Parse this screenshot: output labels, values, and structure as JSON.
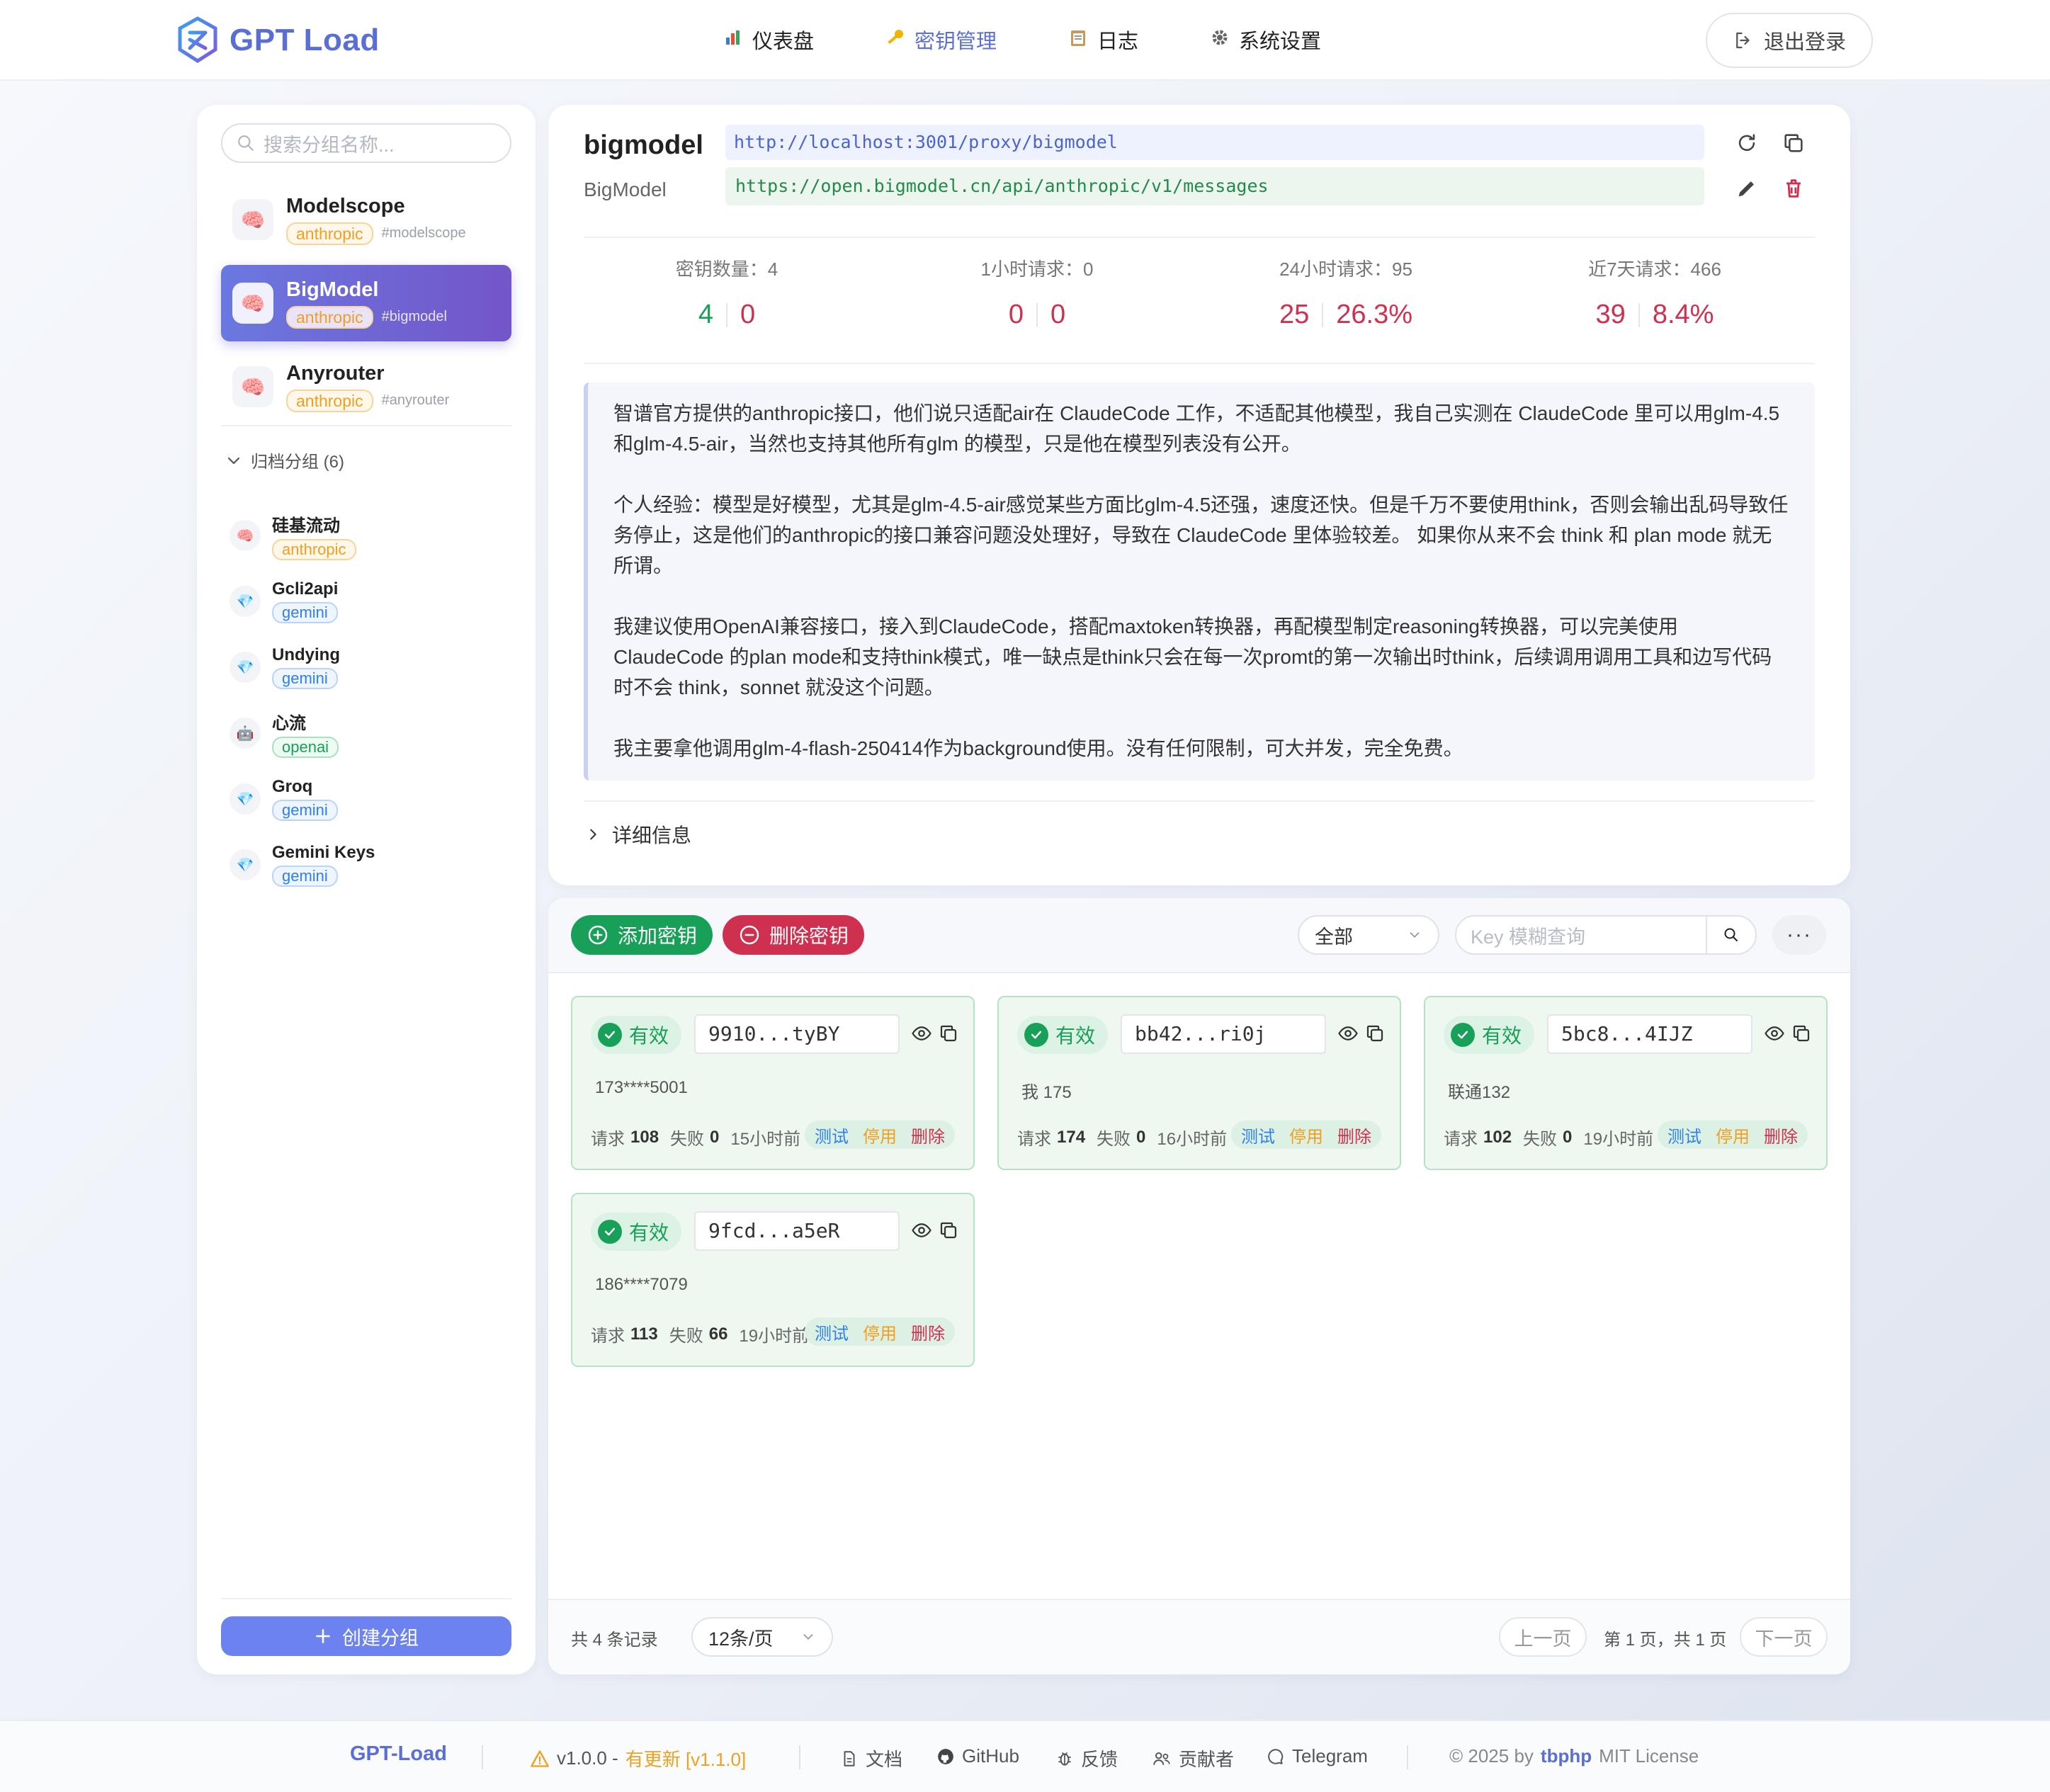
{
  "app": {
    "name": "GPT Load"
  },
  "nav": {
    "items": [
      {
        "label": "仪表盘",
        "icon": "chart-icon"
      },
      {
        "label": "密钥管理",
        "icon": "key-icon"
      },
      {
        "label": "日志",
        "icon": "clipboard-icon"
      },
      {
        "label": "系统设置",
        "icon": "gear-icon"
      }
    ],
    "active": "密钥管理",
    "logout": "退出登录"
  },
  "sidebar": {
    "search_placeholder": "搜索分组名称...",
    "groups": [
      {
        "name": "Modelscope",
        "tag": "anthropic",
        "code": "#modelscope"
      },
      {
        "name": "BigModel",
        "tag": "anthropic",
        "code": "#bigmodel"
      },
      {
        "name": "Anyrouter",
        "tag": "anthropic",
        "code": "#anyrouter"
      }
    ],
    "archived_label": "归档分组 (6)",
    "archived": [
      {
        "name": "硅基流动",
        "tag": "anthropic"
      },
      {
        "name": "Gcli2api",
        "tag": "gemini"
      },
      {
        "name": "Undying",
        "tag": "gemini"
      },
      {
        "name": "心流",
        "tag": "openai"
      },
      {
        "name": "Groq",
        "tag": "gemini"
      },
      {
        "name": "Gemini Keys",
        "tag": "gemini"
      }
    ],
    "create_label": "创建分组"
  },
  "detail": {
    "name": "bigmodel",
    "display_name": "BigModel",
    "proxy_url": "http://localhost:3001/proxy/bigmodel",
    "upstream_url": "https://open.bigmodel.cn/api/anthropic/v1/messages",
    "stats": [
      {
        "label": "密钥数量：4",
        "v1": "4",
        "v2": "0"
      },
      {
        "label": "1小时请求：0",
        "v1": "0",
        "v2": "0"
      },
      {
        "label": "24小时请求：95",
        "v1": "25",
        "v2": "26.3%"
      },
      {
        "label": "近7天请求：466",
        "v1": "39",
        "v2": "8.4%"
      }
    ],
    "description": [
      "智谱官方提供的anthropic接口，他们说只适配air在 ClaudeCode 工作，不适配其他模型，我自己实测在 ClaudeCode 里可以用glm-4.5 和glm-4.5-air，当然也支持其他所有glm 的模型，只是他在模型列表没有公开。",
      "个人经验：模型是好模型，尤其是glm-4.5-air感觉某些方面比glm-4.5还强，速度还快。但是千万不要使用think，否则会输出乱码导致任务停止，这是他们的anthropic的接口兼容问题没处理好，导致在 ClaudeCode 里体验较差。 如果你从来不会 think 和 plan mode 就无所谓。",
      "我建议使用OpenAI兼容接口，接入到ClaudeCode，搭配maxtoken转换器，再配模型制定reasoning转换器，可以完美使用 ClaudeCode 的plan mode和支持think模式，唯一缺点是think只会在每一次promt的第一次输出时think，后续调用调用工具和边写代码时不会 think，sonnet 就没这个问题。",
      "我主要拿他调用glm-4-flash-250414作为background使用。没有任何限制，可大并发，完全免费。"
    ],
    "more_info": "详细信息"
  },
  "keys": {
    "add_label": "添加密钥",
    "delete_label": "删除密钥",
    "filter_value": "全部",
    "search_placeholder": "Key 模糊查询",
    "more": "···",
    "status_label": "有效",
    "req_label": "请求",
    "fail_label": "失败",
    "act_test": "测试",
    "act_disable": "停用",
    "act_delete": "删除",
    "list": [
      {
        "key": "9910...tyBY",
        "note": "173****5001",
        "requests": "108",
        "failures": "0",
        "time": "15小时前"
      },
      {
        "key": "bb42...ri0j",
        "note": "我 175",
        "requests": "174",
        "failures": "0",
        "time": "16小时前"
      },
      {
        "key": "5bc8...4IJZ",
        "note": "联通132",
        "requests": "102",
        "failures": "0",
        "time": "19小时前"
      },
      {
        "key": "9fcd...a5eR",
        "note": "186****7079",
        "requests": "113",
        "failures": "66",
        "time": "19小时前"
      }
    ],
    "pager": {
      "total": "共 4 条记录",
      "page_size": "12条/页",
      "prev": "上一页",
      "info": "第 1 页，共 1 页",
      "next": "下一页"
    }
  },
  "footer": {
    "brand": "GPT-Load",
    "version": "v1.0.0 -",
    "update": "有更新 [v1.1.0]",
    "docs": "文档",
    "github": "GitHub",
    "feedback": "反馈",
    "contributors": "贡献者",
    "telegram": "Telegram",
    "copyright": "© 2025 by",
    "author": "tbphp",
    "license": "MIT License"
  }
}
